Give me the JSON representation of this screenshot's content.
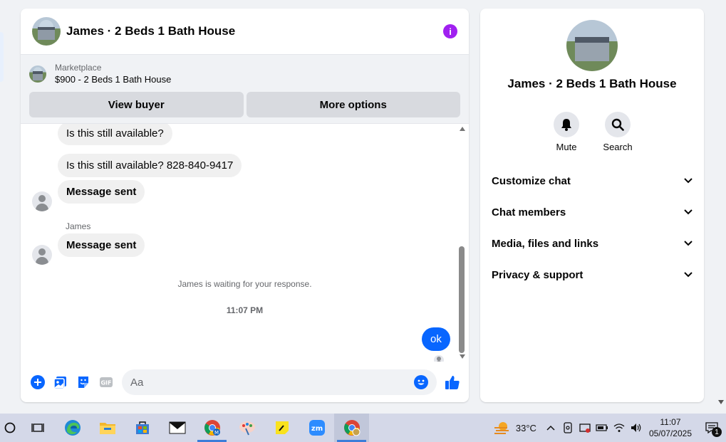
{
  "chat": {
    "title": "James · 2 Beds 1 Bath House",
    "marketplace_label": "Marketplace",
    "listing": "$900 - 2 Beds 1 Bath House",
    "view_buyer": "View buyer",
    "more_options": "More options",
    "messages": [
      {
        "text": "Is this still available?"
      },
      {
        "text": "Is this still available? 828-840-9417"
      },
      {
        "text": "Message sent"
      },
      {
        "sender": "James"
      },
      {
        "text": "Message sent"
      }
    ],
    "system_notice": "James is waiting for your response.",
    "timestamp": "11:07 PM",
    "my_message": "ok",
    "input_placeholder": "Aa"
  },
  "info_panel": {
    "name": "James · 2 Beds 1 Bath House",
    "actions": [
      {
        "label": "Mute",
        "icon": "bell-icon"
      },
      {
        "label": "Search",
        "icon": "search-icon"
      }
    ],
    "sections": [
      {
        "label": "Customize chat"
      },
      {
        "label": "Chat members"
      },
      {
        "label": "Media, files and links"
      },
      {
        "label": "Privacy & support"
      }
    ]
  },
  "taskbar": {
    "temperature": "33°C",
    "time": "11:07",
    "date": "05/07/2025",
    "notification_count": "1",
    "apps": [
      "start-icon",
      "task-view-icon",
      "edge-icon",
      "file-explorer-icon",
      "store-icon",
      "mail-icon",
      "chrome-icon",
      "paint-icon",
      "sticky-notes-icon",
      "zoom-icon",
      "chrome-profile-icon"
    ]
  },
  "colors": {
    "accent_blue": "#0866ff",
    "info_purple": "#a020f0",
    "bubble_gray": "#f0f0f0"
  }
}
